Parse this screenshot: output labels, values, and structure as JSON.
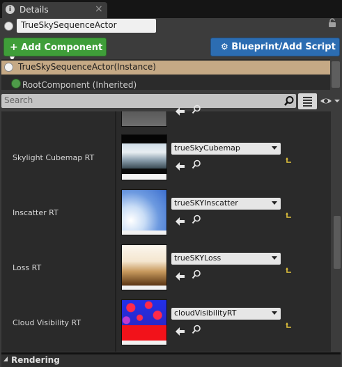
{
  "tab": {
    "title": "Details",
    "icon": "details-info-icon"
  },
  "actor": {
    "name": "TrueSkySequenceActor"
  },
  "toolbar": {
    "add_component_label": "Add Component",
    "blueprint_label": "Blueprint/Add Script"
  },
  "tree": {
    "selected": "TrueSkySequenceActor(Instance)",
    "root": "RootComponent (Inherited)"
  },
  "search": {
    "placeholder": "Search"
  },
  "properties": [
    {
      "label": "Skylight Cubemap RT",
      "value": "trueSkyCubemap"
    },
    {
      "label": "Inscatter RT",
      "value": "trueSKYInscatter"
    },
    {
      "label": "Loss RT",
      "value": "trueSKYLoss"
    },
    {
      "label": "Cloud Visibility RT",
      "value": "cloudVisibilityRT"
    }
  ],
  "sections": {
    "rendering": "Rendering"
  },
  "colors": {
    "add_component": "#3f9e39",
    "blueprint": "#2c6db2",
    "selection": "#c5a985"
  }
}
